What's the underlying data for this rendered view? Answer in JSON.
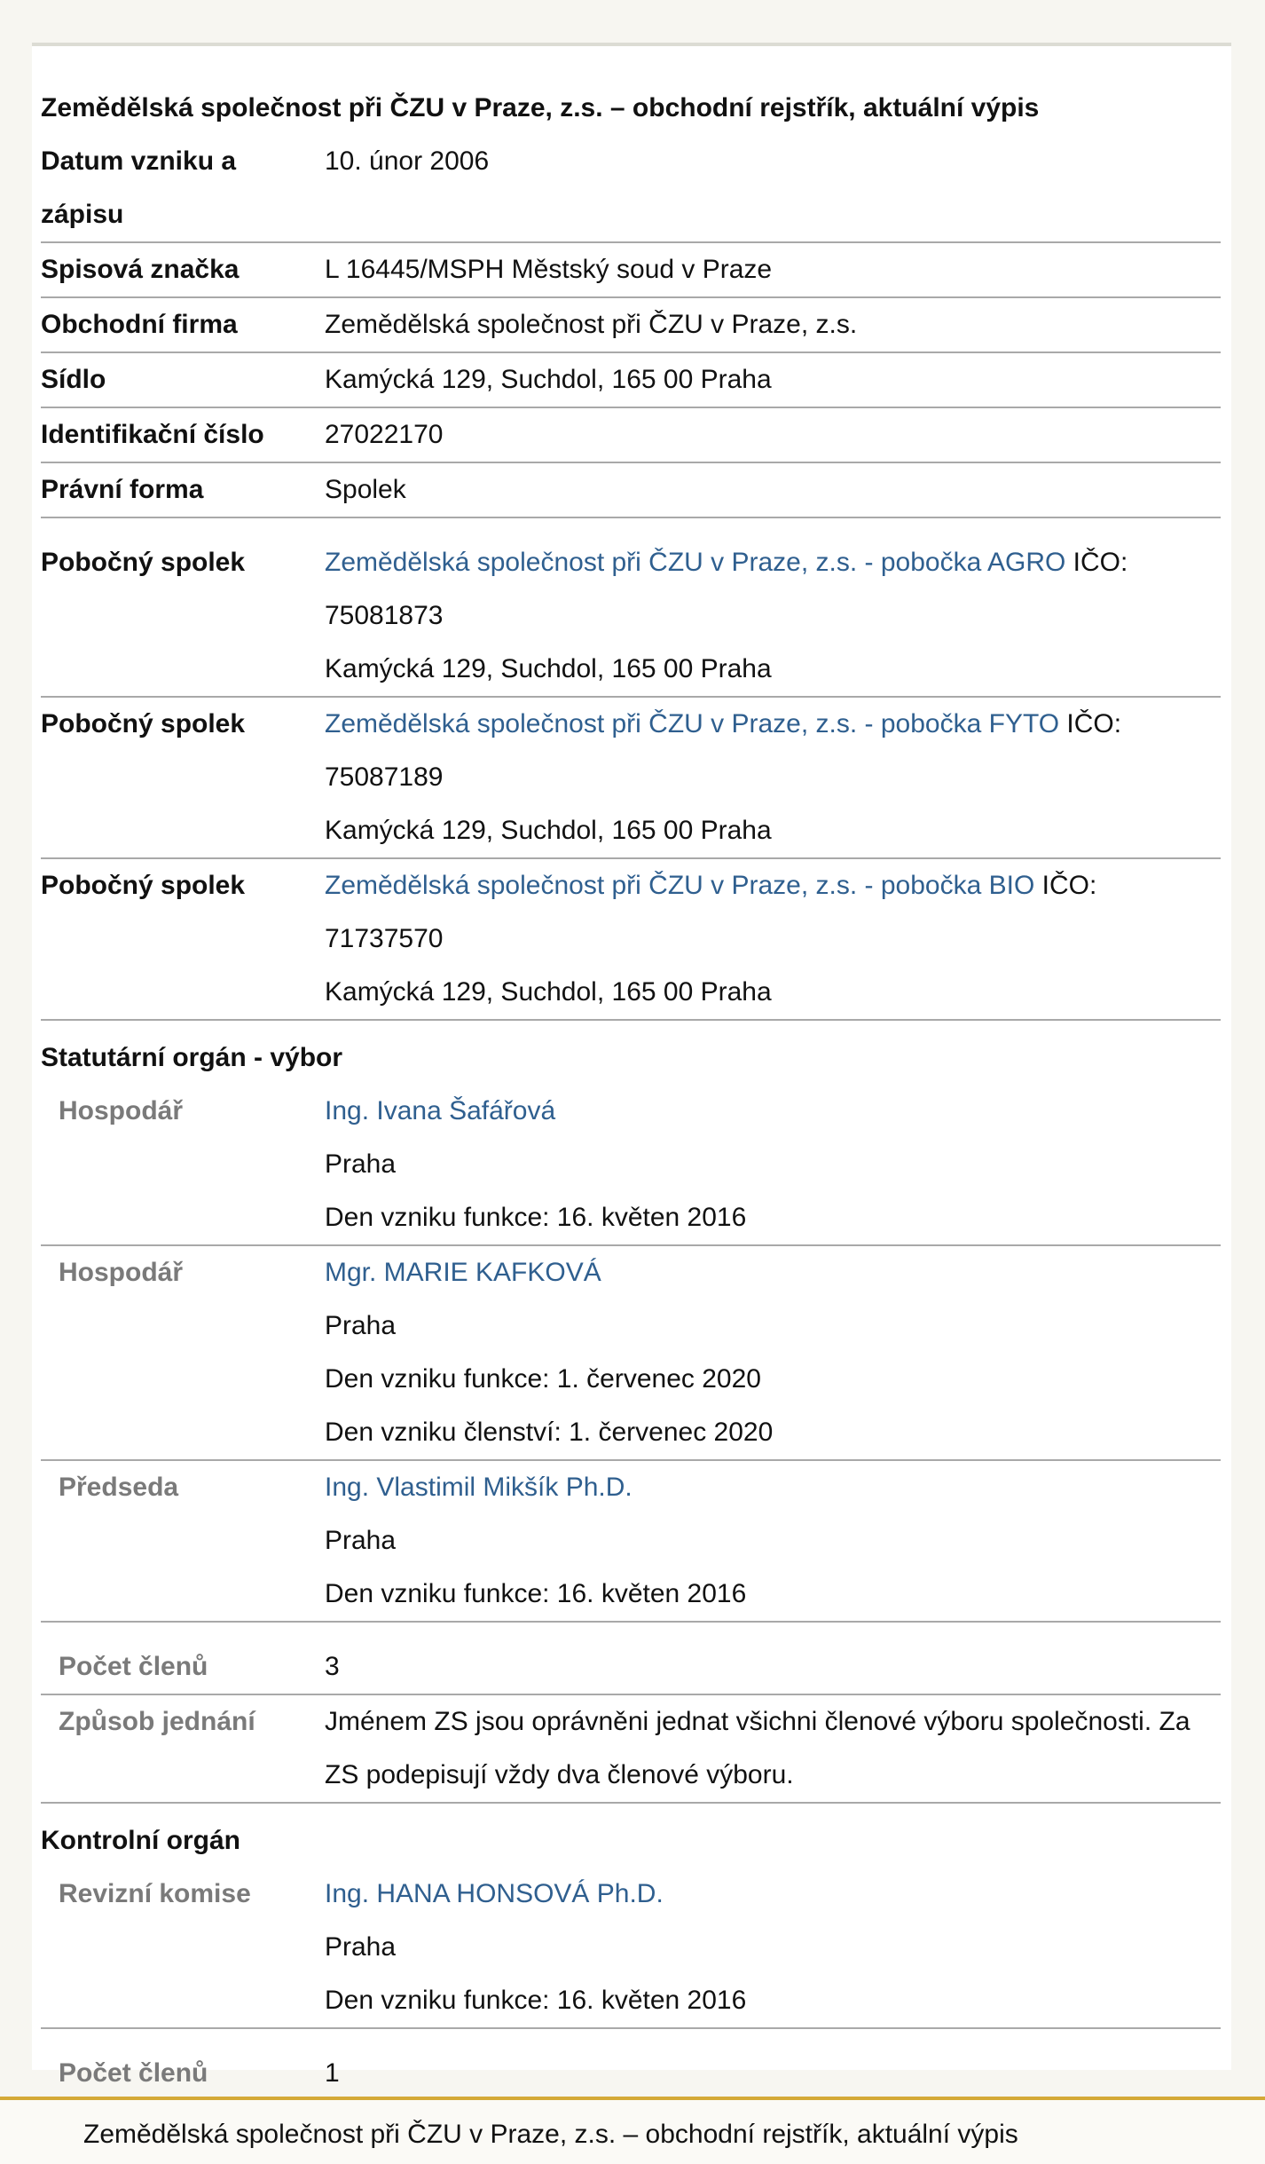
{
  "title": "Zemědělská společnost při ČZU v Praze, z.s. – obchodní rejstřík, aktuální výpis",
  "basic": [
    {
      "label": "Datum vzniku a",
      "label2": "zápisu",
      "value": "10. únor 2006"
    },
    {
      "label": "Spisová značka",
      "value": "L 16445/MSPH Městský soud v Praze"
    },
    {
      "label": "Obchodní firma",
      "value": "Zemědělská společnost při ČZU v Praze, z.s."
    },
    {
      "label": "Sídlo",
      "value": "Kamýcká 129, Suchdol, 165 00 Praha"
    },
    {
      "label": "Identifikační číslo",
      "value": "27022170"
    },
    {
      "label": "Právní forma",
      "value": "Spolek"
    }
  ],
  "branches": [
    {
      "label": "Pobočný spolek",
      "link": "Zemědělská společnost při ČZU v Praze, z.s. - pobočka AGRO",
      "ico_text": " IČO:",
      "ico_line": "75081873",
      "address": "Kamýcká 129, Suchdol, 165 00 Praha"
    },
    {
      "label": "Pobočný spolek",
      "link": "Zemědělská společnost při ČZU v Praze, z.s. - pobočka FYTO",
      "ico_text": " IČO:",
      "ico_line": "75087189",
      "address": "Kamýcká 129, Suchdol, 165 00 Praha"
    },
    {
      "label": "Pobočný spolek",
      "link": "Zemědělská společnost při ČZU v Praze, z.s. - pobočka BIO",
      "ico_text": " IČO: 71737570",
      "address": "Kamýcká 129, Suchdol, 165 00 Praha"
    }
  ],
  "statutory": {
    "heading": "Statutární orgán - výbor",
    "members": [
      {
        "role": "Hospodář",
        "name": "Ing. Ivana Šafářová",
        "city": "Praha",
        "since": "Den vzniku funkce: 16. květen 2016"
      },
      {
        "role": "Hospodář",
        "name": "Mgr. MARIE KAFKOVÁ",
        "city": "Praha",
        "since": "Den vzniku funkce: 1. červenec 2020",
        "membership": "Den vzniku členství: 1. červenec 2020"
      },
      {
        "role": "Předseda",
        "name": "Ing. Vlastimil Mikšík Ph.D.",
        "city": "Praha",
        "since": "Den vzniku funkce: 16. květen 2016"
      }
    ],
    "count_label": "Počet členů",
    "count": "3",
    "method_label": "Způsob jednání",
    "method_line1": "Jménem ZS jsou oprávněni jednat všichni členové výboru společnosti. Za",
    "method_line2": "ZS podepisují vždy dva členové výboru."
  },
  "control": {
    "heading": "Kontrolní orgán",
    "role": "Revizní komise",
    "name": "Ing. HANA HONSOVÁ Ph.D.",
    "city": "Praha",
    "since": "Den vzniku funkce: 16. květen 2016",
    "count_label": "Počet členů",
    "count": "1"
  },
  "footer": "Zemědělská společnost při ČZU v Praze, z.s. – obchodní rejstřík, aktuální výpis"
}
